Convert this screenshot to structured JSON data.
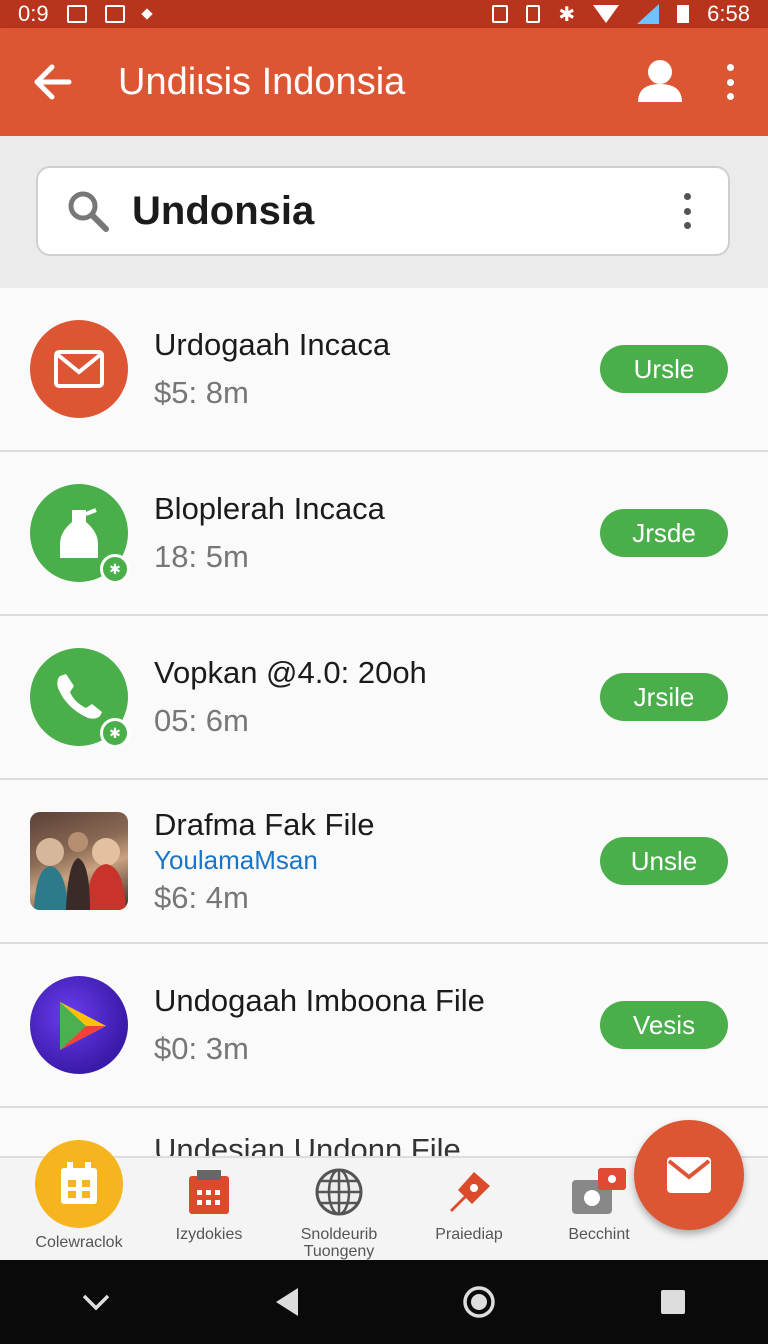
{
  "status_bar": {
    "time_left": "0:9",
    "time_right": "6:58"
  },
  "app_bar": {
    "title": "Undiιsis Indonsia"
  },
  "search": {
    "query": "Undonsia"
  },
  "items": [
    {
      "title": "Urdogaah Incaca",
      "meta": "$5: 8m",
      "action": "Ursle",
      "icon": "mail-icon"
    },
    {
      "title": "Bloplerah Incaca",
      "meta": "18: 5m",
      "action": "Jrsde",
      "icon": "bottle-icon"
    },
    {
      "title": "Vopkan @4.0: 20oh",
      "meta": "05: 6m",
      "action": "Jrsile",
      "icon": "phone-icon"
    },
    {
      "title": "Drafma Fak File",
      "subtitle": "YoulamaMsan",
      "meta": "$6: 4m",
      "action": "Unsle",
      "icon": "photo-thumbnail"
    },
    {
      "title": "Undogaah Imboona File",
      "meta": "$0: 3m",
      "action": "Vesis",
      "icon": "play-store-icon"
    },
    {
      "title": "Undesian Undonn File"
    }
  ],
  "bottom_nav": [
    {
      "label": "Colewraclok",
      "icon": "calendar-icon"
    },
    {
      "label": "Izydokies",
      "icon": "calendar-grid-icon"
    },
    {
      "label": "Snoldeurib Tuongeny",
      "icon": "globe-icon"
    },
    {
      "label": "Praiediap",
      "icon": "pin-icon"
    },
    {
      "label": "Becchint",
      "icon": "camera-icon"
    }
  ],
  "colors": {
    "accent": "#dc5634",
    "status_bar": "#b8341c",
    "green": "#4aaf4b",
    "link": "#1a75c9"
  }
}
